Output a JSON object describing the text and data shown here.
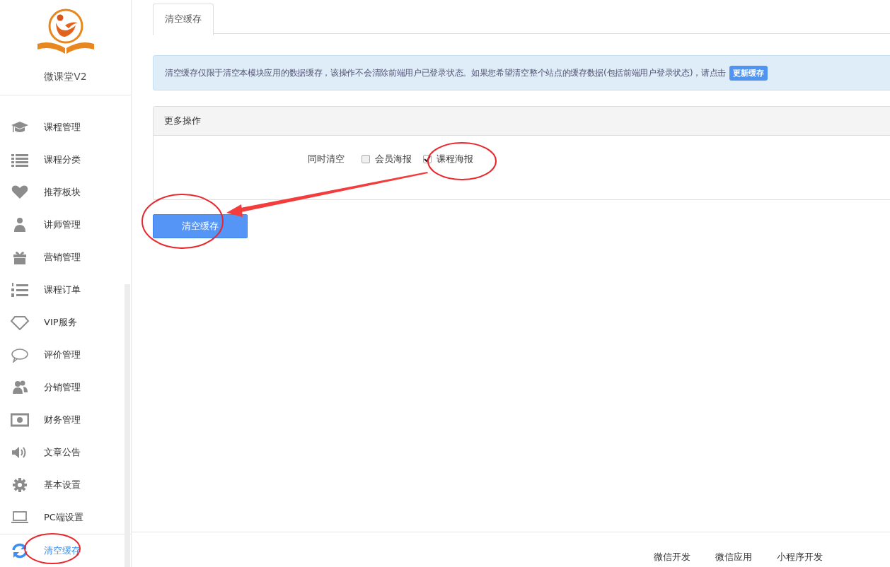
{
  "sidebar": {
    "app_name": "微课堂V2",
    "items": [
      {
        "label": "课程管理",
        "selected": false
      },
      {
        "label": "课程分类",
        "selected": false
      },
      {
        "label": "推荐板块",
        "selected": false
      },
      {
        "label": "讲师管理",
        "selected": false
      },
      {
        "label": "营销管理",
        "selected": false
      },
      {
        "label": "课程订单",
        "selected": false
      },
      {
        "label": "VIP服务",
        "selected": false
      },
      {
        "label": "评价管理",
        "selected": false
      },
      {
        "label": "分销管理",
        "selected": false
      },
      {
        "label": "财务管理",
        "selected": false
      },
      {
        "label": "文章公告",
        "selected": false
      },
      {
        "label": "基本设置",
        "selected": false
      },
      {
        "label": "PC端设置",
        "selected": false
      },
      {
        "label": "清空缓存",
        "selected": true
      }
    ]
  },
  "tabs": [
    {
      "label": "清空缓存",
      "selected": true
    }
  ],
  "alert": {
    "text": "清空缓存仅限于清空本模块应用的数据缓存，该操作不会清除前端用户已登录状态。如果您希望清空整个站点的缓存数据(包括前端用户登录状态)，请点击",
    "button": "更新缓存"
  },
  "panel": {
    "title": "更多操作",
    "field_label": "同时清空",
    "options": [
      {
        "label": "会员海报",
        "checked": false
      },
      {
        "label": "课程海报",
        "checked": true
      }
    ]
  },
  "submit_button": "清空缓存",
  "footer": {
    "links": [
      "微信开发",
      "微信应用",
      "小程序开发"
    ]
  }
}
